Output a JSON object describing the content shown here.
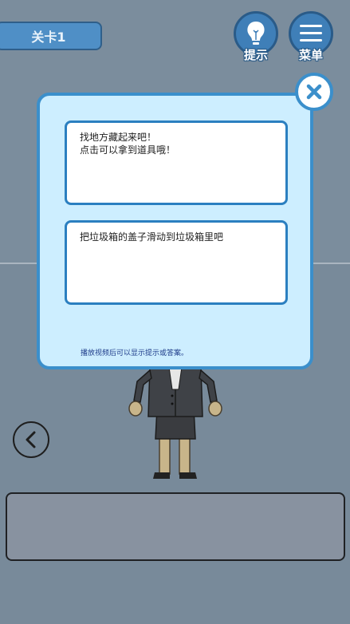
{
  "header": {
    "level_label": "关卡1",
    "hint_label": "提示",
    "menu_label": "菜单"
  },
  "dialog": {
    "hint1_line1": "找地方藏起来吧！",
    "hint1_line2": "点击可以拿到道具哦！",
    "hint2_line1": "把垃圾箱的盖子滑动到垃圾箱里吧",
    "note": "播放视频后可以显示提示或答案。"
  },
  "icons": {
    "hint": "lightbulb-icon",
    "menu": "hamburger-menu-icon",
    "close": "close-icon",
    "back": "chevron-left-icon"
  },
  "colors": {
    "accent": "#3b8fcb",
    "dialog_bg": "#cdeeff",
    "button_blue": "#3f7fb8"
  }
}
